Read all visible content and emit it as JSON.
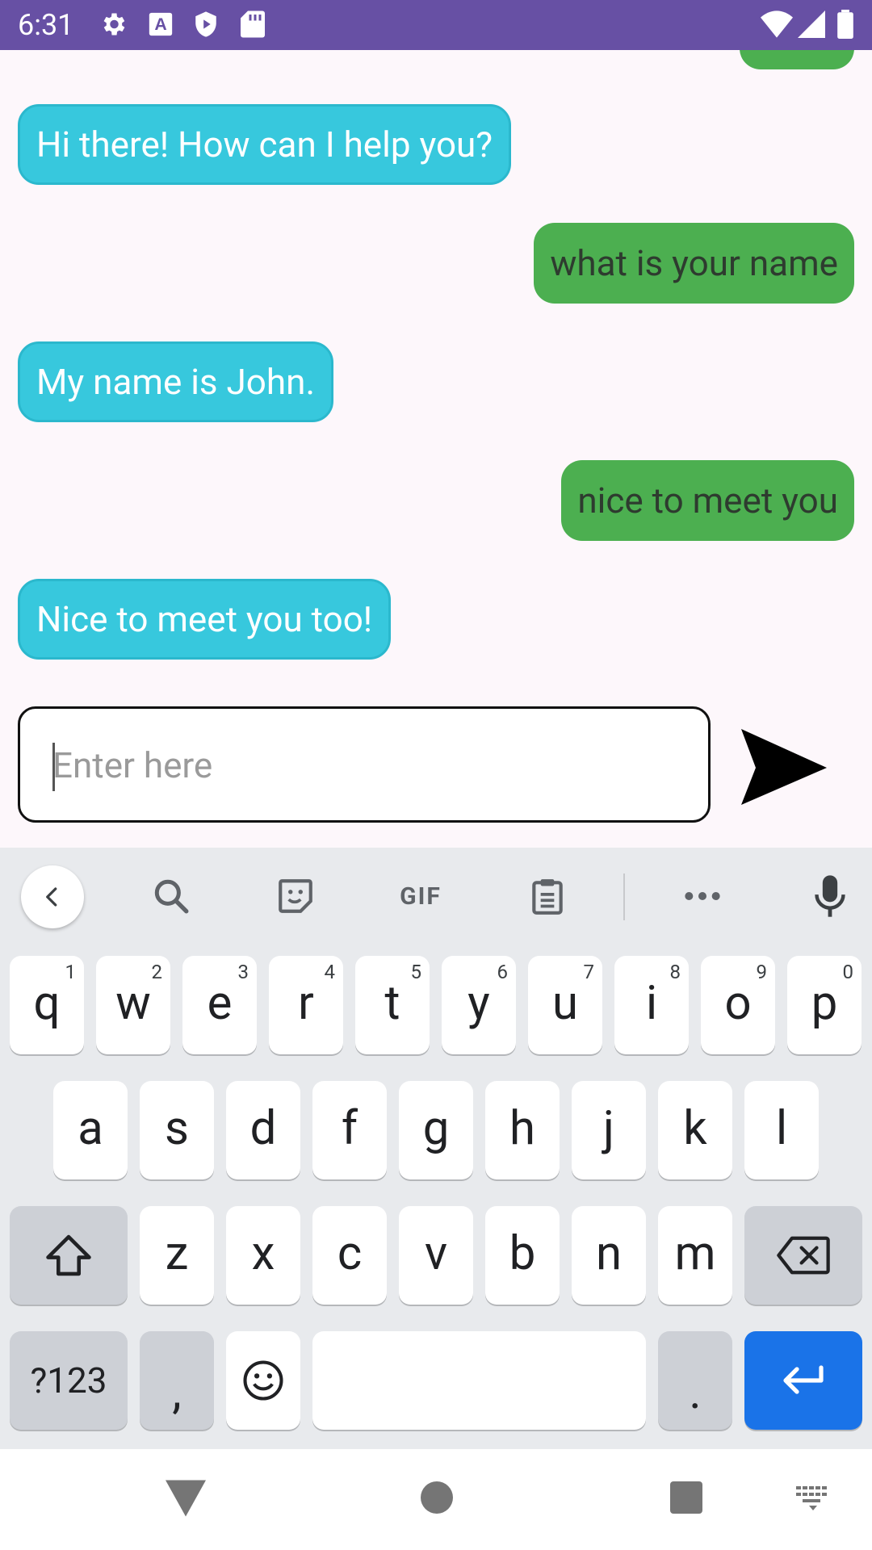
{
  "status_bar": {
    "time": "6:31",
    "icons": [
      "gear-icon",
      "a-box-icon",
      "shield-play-icon",
      "sd-card-icon"
    ],
    "right_icons": [
      "wifi-icon",
      "signal-icon",
      "battery-icon"
    ]
  },
  "chat": {
    "messages": [
      {
        "from": "bot",
        "text": "Hi there! How can I help you?"
      },
      {
        "from": "user",
        "text": "what is your name"
      },
      {
        "from": "bot",
        "text": "My name is John."
      },
      {
        "from": "user",
        "text": "nice to meet you"
      },
      {
        "from": "bot",
        "text": "Nice to meet you too!"
      }
    ],
    "bot_color": "#37c8dd",
    "user_color": "#4caf50"
  },
  "input": {
    "placeholder": "Enter here",
    "value": ""
  },
  "keyboard": {
    "toolbar": {
      "gif_label": "GIF",
      "icons": [
        "collapse-icon",
        "search-icon",
        "sticker-icon",
        "gif-icon",
        "clipboard-icon",
        "more-icon",
        "mic-icon"
      ]
    },
    "row1": [
      {
        "c": "q",
        "h": "1"
      },
      {
        "c": "w",
        "h": "2"
      },
      {
        "c": "e",
        "h": "3"
      },
      {
        "c": "r",
        "h": "4"
      },
      {
        "c": "t",
        "h": "5"
      },
      {
        "c": "y",
        "h": "6"
      },
      {
        "c": "u",
        "h": "7"
      },
      {
        "c": "i",
        "h": "8"
      },
      {
        "c": "o",
        "h": "9"
      },
      {
        "c": "p",
        "h": "0"
      }
    ],
    "row2": [
      "a",
      "s",
      "d",
      "f",
      "g",
      "h",
      "j",
      "k",
      "l"
    ],
    "row3": [
      "z",
      "x",
      "c",
      "v",
      "b",
      "n",
      "m"
    ],
    "symbols_label": "?123",
    "comma": ",",
    "period": ".",
    "accent_color": "#1a73e8"
  },
  "nav_bar": {
    "icons": [
      "back-icon",
      "home-icon",
      "recents-icon",
      "keyboard-switch-icon"
    ]
  }
}
